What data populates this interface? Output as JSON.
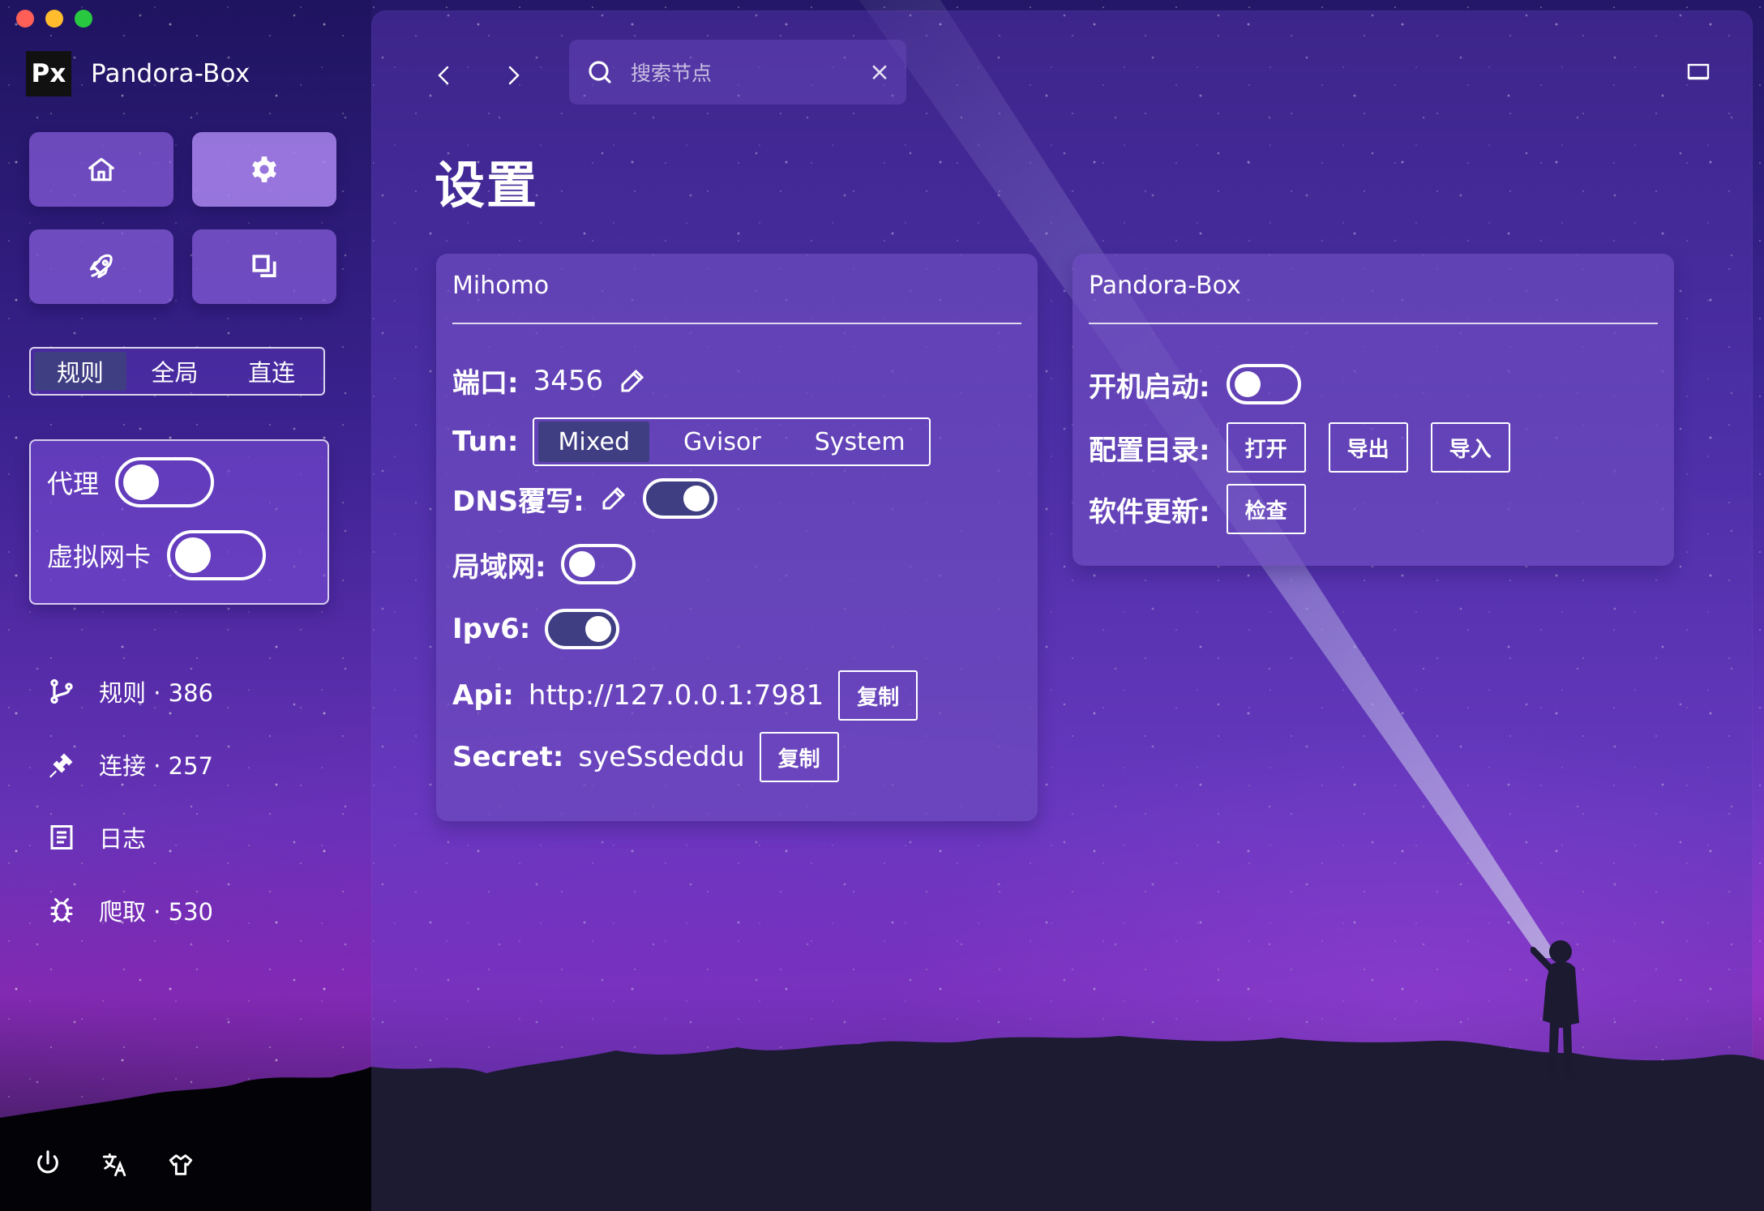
{
  "app": {
    "name": "Pandora-Box",
    "logo_text": "Px"
  },
  "window_controls": [
    "close",
    "minimize",
    "maximize"
  ],
  "sidebar": {
    "nav_buttons": [
      {
        "name": "home",
        "icon": "home-icon",
        "active": false
      },
      {
        "name": "settings",
        "icon": "gear-icon",
        "active": true
      },
      {
        "name": "launch",
        "icon": "rocket-icon",
        "active": false
      },
      {
        "name": "windows",
        "icon": "window-stack-icon",
        "active": false
      }
    ],
    "modes": [
      "规则",
      "全局",
      "直连"
    ],
    "selected_mode": "规则",
    "toggles": [
      {
        "label": "代理",
        "enabled": false
      },
      {
        "label": "虚拟网卡",
        "enabled": false
      }
    ],
    "items": [
      {
        "label": "规则 · 386",
        "icon": "rule-branch-icon"
      },
      {
        "label": "连接 · 257",
        "icon": "connection-icon"
      },
      {
        "label": "日志",
        "icon": "log-icon"
      },
      {
        "label": "爬取 · 530",
        "icon": "bug-icon"
      }
    ],
    "footer_icons": [
      "power-icon",
      "translate-icon",
      "shirt-icon"
    ]
  },
  "topbar": {
    "search_placeholder": "搜索节点",
    "search_icon": "search-icon",
    "clear_icon": "close-icon",
    "back_icon": "chevron-left-icon",
    "forward_icon": "chevron-right-icon",
    "window_icon": "window-icon"
  },
  "page": {
    "title": "设置"
  },
  "mihomo": {
    "title": "Mihomo",
    "port_label": "端口:",
    "port_value": "3456",
    "tun_label": "Tun:",
    "tun_options": [
      "Mixed",
      "Gvisor",
      "System"
    ],
    "tun_selected": "Mixed",
    "dns_label": "DNS覆写:",
    "dns_enabled": true,
    "lan_label": "局域网:",
    "lan_enabled": false,
    "ipv6_label": "Ipv6:",
    "ipv6_enabled": true,
    "api_label": "Api:",
    "api_value": "http://127.0.0.1:7981",
    "secret_label": "Secret:",
    "secret_value": "syeSsdeddu",
    "copy_label": "复制"
  },
  "pandora": {
    "title": "Pandora-Box",
    "startup_label": "开机启动:",
    "startup_enabled": false,
    "config_label": "配置目录:",
    "config_buttons": [
      "打开",
      "导出",
      "导入"
    ],
    "update_label": "软件更新:",
    "update_button": "检查"
  },
  "colors": {
    "selected": "#3f3e83",
    "panel": "#6c4bbe",
    "text": "#ffffff",
    "beam": "#d7f2ff"
  }
}
